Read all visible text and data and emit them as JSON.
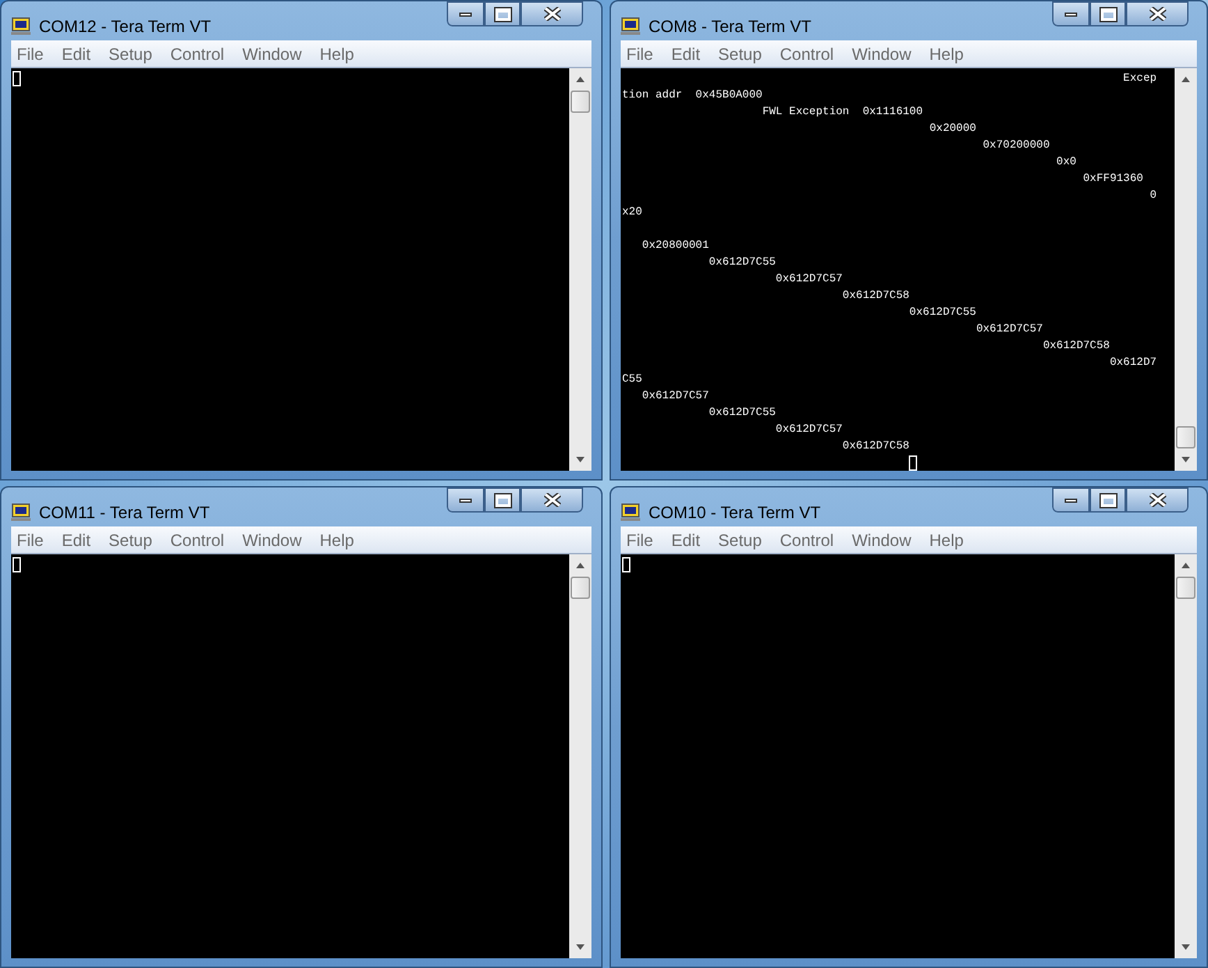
{
  "windows": [
    {
      "title": "COM12 - Tera Term VT",
      "menu": [
        "File",
        "Edit",
        "Setup",
        "Control",
        "Window",
        "Help"
      ],
      "scrolled_to_end": false,
      "cursor": true
    },
    {
      "title": "COM8 - Tera Term VT",
      "menu": [
        "File",
        "Edit",
        "Setup",
        "Control",
        "Window",
        "Help"
      ],
      "scrolled_to_end": true,
      "cursor": true,
      "lines": [
        {
          "text": "                                                                           Excep"
        },
        {
          "text": "tion addr  0x45B0A000"
        },
        {
          "text": "                     FWL Exception  0x1116100"
        },
        {
          "text": "                                              0x20000"
        },
        {
          "text": "                                                      0x70200000"
        },
        {
          "text": "                                                                 0x0"
        },
        {
          "text": "                                                                     0xFF91360"
        },
        {
          "text": "                                                                               0"
        },
        {
          "text": "x20",
          "blank_after": true
        },
        {
          "text": "   0x20800001"
        },
        {
          "text": "             0x612D7C55"
        },
        {
          "text": "                       0x612D7C57"
        },
        {
          "text": "                                 0x612D7C58"
        },
        {
          "text": "                                           0x612D7C55"
        },
        {
          "text": "                                                     0x612D7C57"
        },
        {
          "text": "                                                               0x612D7C58"
        },
        {
          "text": "                                                                         0x612D7"
        },
        {
          "text": "C55"
        },
        {
          "text": "   0x612D7C57"
        },
        {
          "text": "             0x612D7C55"
        },
        {
          "text": "                       0x612D7C57"
        },
        {
          "text": "                                 0x612D7C58"
        }
      ]
    },
    {
      "title": "COM11 - Tera Term VT",
      "menu": [
        "File",
        "Edit",
        "Setup",
        "Control",
        "Window",
        "Help"
      ],
      "scrolled_to_end": false,
      "cursor": true
    },
    {
      "title": "COM10 - Tera Term VT",
      "menu": [
        "File",
        "Edit",
        "Setup",
        "Control",
        "Window",
        "Help"
      ],
      "scrolled_to_end": false,
      "cursor": true
    }
  ]
}
